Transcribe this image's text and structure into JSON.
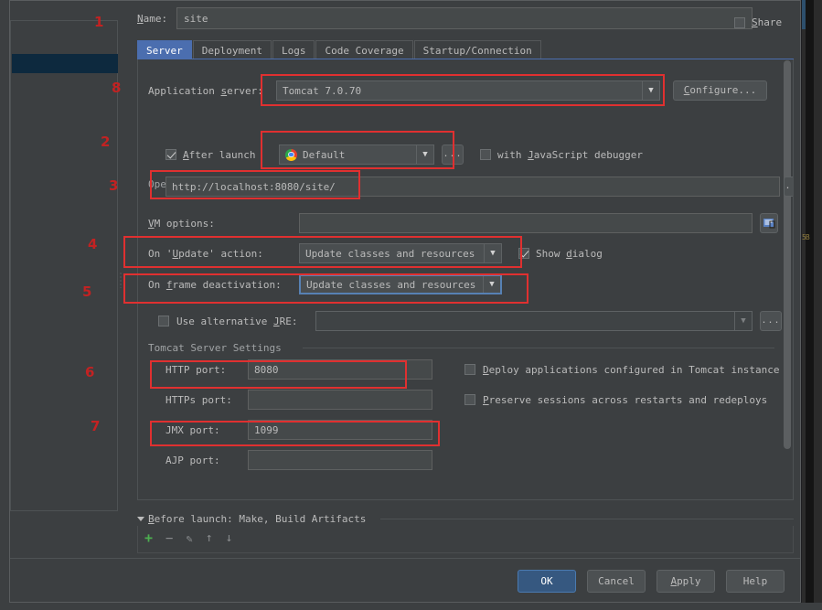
{
  "dialog": {
    "name_label": "Name:",
    "name_value": "site",
    "share_label": "Share",
    "share_checked": false
  },
  "tabs": [
    {
      "label": "Server",
      "active": true
    },
    {
      "label": "Deployment",
      "active": false
    },
    {
      "label": "Logs",
      "active": false
    },
    {
      "label": "Code Coverage",
      "active": false
    },
    {
      "label": "Startup/Connection",
      "active": false
    }
  ],
  "server": {
    "application_server_label": "Application server:",
    "application_server_value": "Tomcat 7.0.70",
    "configure_button": "Configure...",
    "open_browser_group": "Open browser",
    "after_launch_label": "After launch",
    "after_launch_checked": true,
    "browser_value": "Default",
    "browser_icon": "chrome-icon",
    "browser_ellipsis": "...",
    "with_js_debugger_label": "with JavaScript debugger",
    "with_js_debugger_checked": false,
    "url_value": "http://localhost:8080/site/",
    "url_ellipsis": "...",
    "vm_options_label": "VM options:",
    "vm_options_value": "",
    "vm_options_expand_icon": "expand-editor-icon",
    "on_update_label": "On 'Update' action:",
    "on_update_value": "Update classes and resources",
    "show_dialog_label": "Show dialog",
    "show_dialog_checked": true,
    "on_frame_deactivation_label": "On frame deactivation:",
    "on_frame_deactivation_value": "Update classes and resources",
    "use_alt_jre_label": "Use alternative JRE:",
    "use_alt_jre_checked": false,
    "alt_jre_value": "",
    "alt_jre_ellipsis": "..."
  },
  "tomcat_settings": {
    "group_title": "Tomcat Server Settings",
    "http_port_label": "HTTP port:",
    "http_port_value": "8080",
    "https_port_label": "HTTPs port:",
    "https_port_value": "",
    "jmx_port_label": "JMX port:",
    "jmx_port_value": "1099",
    "ajp_port_label": "AJP port:",
    "ajp_port_value": "",
    "deploy_apps_label": "Deploy applications configured in Tomcat instance",
    "deploy_apps_checked": false,
    "preserve_sessions_label": "Preserve sessions across restarts and redeploys",
    "preserve_sessions_checked": false
  },
  "before_launch": {
    "title": "Before launch: Make, Build Artifacts",
    "toolbar": [
      {
        "name": "add-icon",
        "glyph": "+"
      },
      {
        "name": "remove-icon",
        "glyph": "−"
      },
      {
        "name": "edit-pencil-icon",
        "glyph": "✎"
      },
      {
        "name": "move-up-icon",
        "glyph": "↑"
      },
      {
        "name": "move-down-icon",
        "glyph": "↓"
      }
    ]
  },
  "footer": {
    "ok": "OK",
    "cancel": "Cancel",
    "apply": "Apply",
    "help": "Help"
  },
  "annotations": {
    "color": "#c22222",
    "numbers": [
      "1",
      "2",
      "3",
      "4",
      "5",
      "6",
      "7",
      "8"
    ]
  },
  "colors": {
    "dialog_bg": "#3c3f41",
    "field_bg": "#45494a",
    "accent_blue": "#4b6eaf",
    "primary_button": "#365880",
    "annotation_red": "#e03030",
    "selection_blue": "#0d293e"
  }
}
